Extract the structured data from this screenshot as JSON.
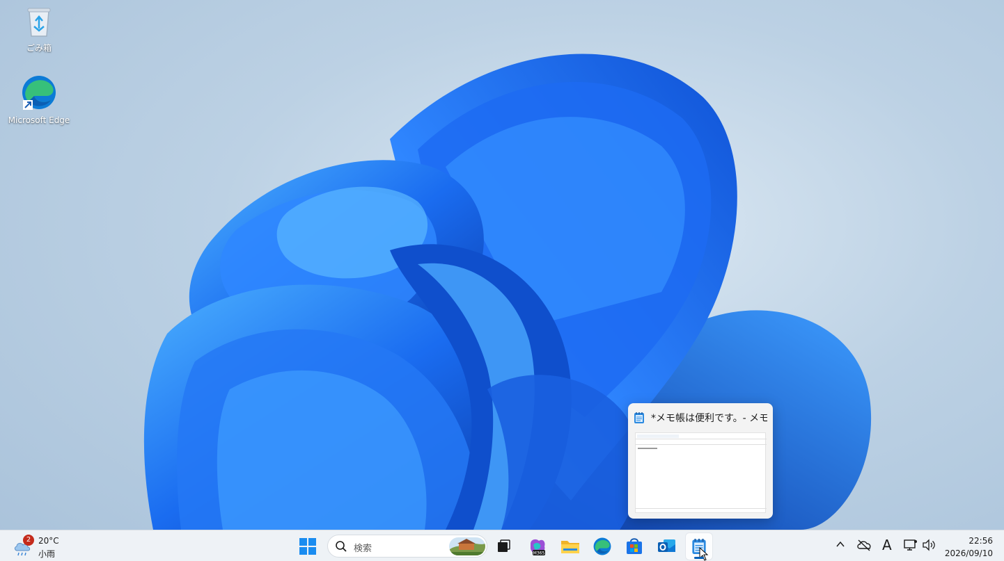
{
  "desktop": {
    "icons": [
      {
        "label": "ごみ箱",
        "icon": "recycle-bin-icon"
      },
      {
        "label": "Microsoft Edge",
        "icon": "edge-icon"
      }
    ]
  },
  "preview": {
    "title": "*メモ帳は便利です。- メモ...",
    "app_icon": "notepad-icon"
  },
  "taskbar": {
    "weather": {
      "temp": "20°C",
      "condition": "小雨",
      "badge": "2"
    },
    "search": {
      "placeholder": "検索"
    },
    "apps": [
      {
        "name": "Start",
        "icon": "windows-start-icon"
      },
      {
        "name": "Task View",
        "icon": "task-view-icon"
      },
      {
        "name": "Microsoft 365",
        "icon": "m365-icon",
        "label": "M365"
      },
      {
        "name": "File Explorer",
        "icon": "folder-icon"
      },
      {
        "name": "Microsoft Edge",
        "icon": "edge-icon"
      },
      {
        "name": "Microsoft Store",
        "icon": "store-icon"
      },
      {
        "name": "Outlook",
        "icon": "outlook-icon"
      },
      {
        "name": "Notepad",
        "icon": "notepad-icon",
        "active": true
      }
    ],
    "tray": {
      "ime": "A",
      "time": "22:56",
      "date": "2026/09/10"
    }
  },
  "colors": {
    "accent": "#005fb8",
    "bloom_dark": "#0a3fbf",
    "bloom_light": "#3a9bff"
  }
}
